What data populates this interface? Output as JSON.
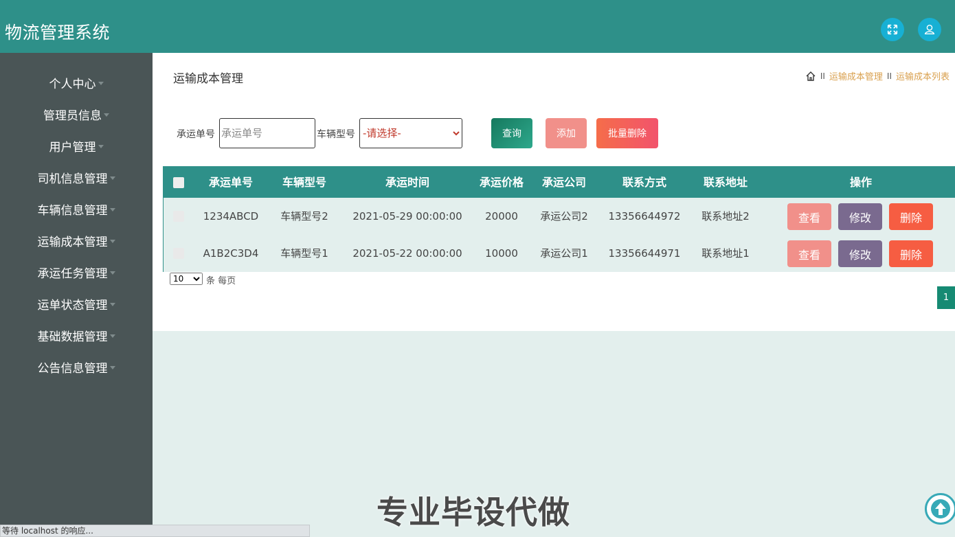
{
  "app": {
    "title": "物流管理系统"
  },
  "header": {
    "fullscreen_icon": "expand-icon",
    "user_icon": "user-icon"
  },
  "sidebar": {
    "items": [
      {
        "label": "个人中心"
      },
      {
        "label": "管理员信息"
      },
      {
        "label": "用户管理"
      },
      {
        "label": "司机信息管理"
      },
      {
        "label": "车辆信息管理"
      },
      {
        "label": "运输成本管理"
      },
      {
        "label": "承运任务管理"
      },
      {
        "label": "运单状态管理"
      },
      {
        "label": "基础数据管理"
      },
      {
        "label": "公告信息管理"
      }
    ]
  },
  "page": {
    "title": "运输成本管理",
    "breadcrumb": {
      "separator": "II",
      "items": [
        "运输成本管理",
        "运输成本列表"
      ]
    }
  },
  "search": {
    "order_label": "承运单号",
    "order_placeholder": "承运单号",
    "vehicle_label": "车辆型号",
    "vehicle_selected": "-请选择-",
    "query_label": "查询",
    "add_label": "添加",
    "batch_delete_label": "批量删除"
  },
  "table": {
    "columns": [
      "承运单号",
      "车辆型号",
      "承运时间",
      "承运价格",
      "承运公司",
      "联系方式",
      "联系地址",
      "操作"
    ],
    "rows": [
      {
        "order": "1234ABCD",
        "vehicle": "车辆型号2",
        "time": "2021-05-29 00:00:00",
        "price": "20000",
        "company": "承运公司2",
        "phone": "13356644972",
        "address": "联系地址2"
      },
      {
        "order": "A1B2C3D4",
        "vehicle": "车辆型号1",
        "time": "2021-05-22 00:00:00",
        "price": "10000",
        "company": "承运公司1",
        "phone": "13356644971",
        "address": "联系地址1"
      }
    ],
    "actions": {
      "view": "查看",
      "edit": "修改",
      "delete": "删除"
    }
  },
  "pagination": {
    "page_size": "10",
    "per_page_text": "条 每页",
    "current_page": "1"
  },
  "overlay": {
    "text": "专业毕设代做"
  },
  "status_bar": {
    "text": "等待 localhost 的响应..."
  },
  "colors": {
    "header": "#2e9089",
    "sidebar": "#4a5556",
    "accent": "#d9a04e"
  }
}
